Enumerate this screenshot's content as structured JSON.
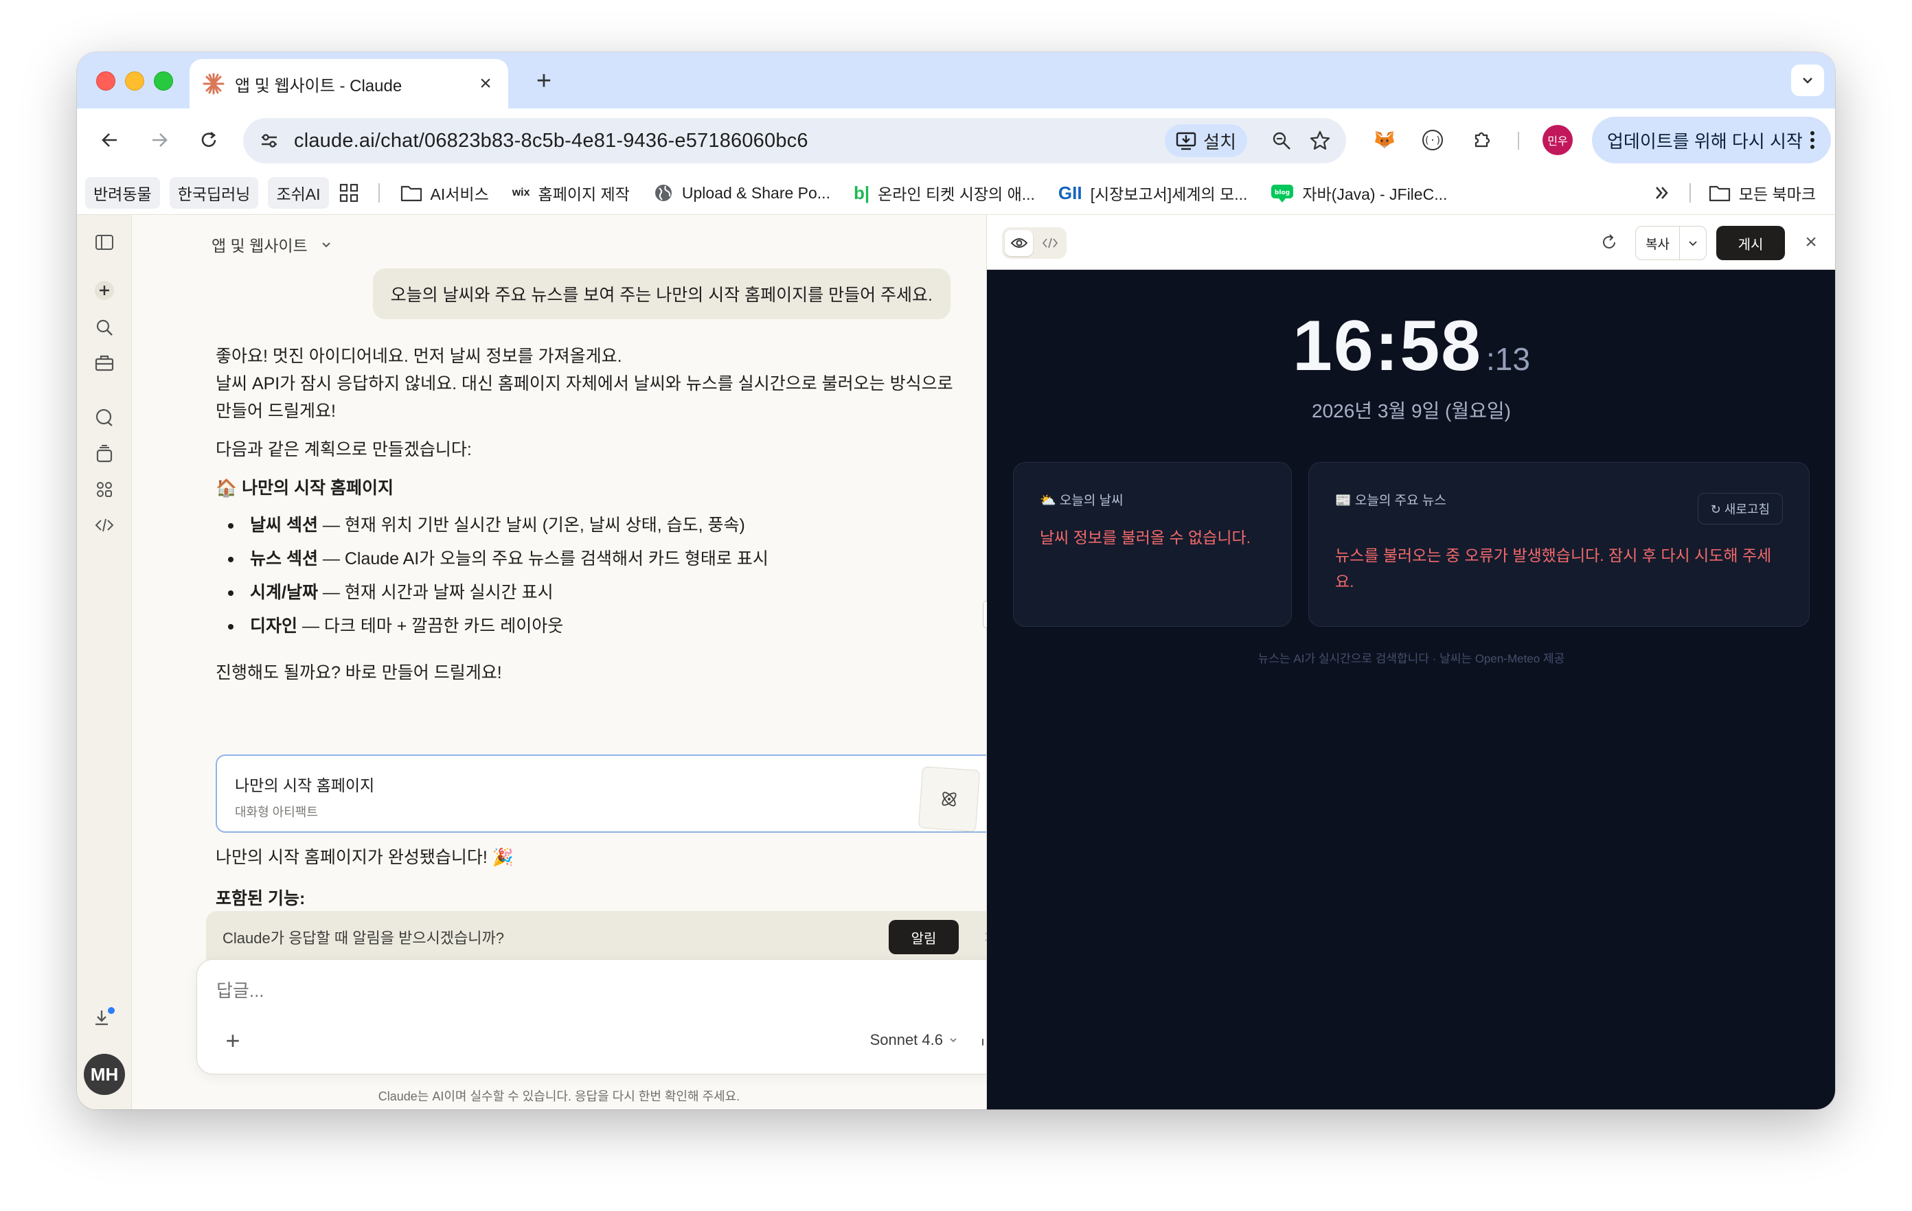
{
  "tab": {
    "title": "앱 및 웹사이트 - Claude",
    "close": "×",
    "new_tab": "+"
  },
  "toolbar": {
    "url": "claude.ai/chat/06823b83-8c5b-4e81-9436-e57186060bc6",
    "install_label": "설치",
    "profile_initials": "민우",
    "update_label": "업데이트를 위해 다시 시작"
  },
  "bookmarks": {
    "chips": [
      "반려동물",
      "한국딥러닝",
      "조쉬AI"
    ],
    "items": [
      {
        "label": "AI서비스",
        "icon": "folder-icon"
      },
      {
        "label": "홈페이지 제작",
        "icon": "wix-icon"
      },
      {
        "label": "Upload & Share Po...",
        "icon": "globe-icon"
      },
      {
        "label": "온라인 티켓 시장의 애...",
        "icon": "bl-icon"
      },
      {
        "label": "[시장보고서]세계의 모...",
        "icon": "gii-icon"
      },
      {
        "label": "자바(Java) - JFileC...",
        "icon": "blog-icon"
      }
    ],
    "all_bookmarks": "모든 북마크"
  },
  "chat": {
    "header_title": "앱 및 웹사이트",
    "user_message": "오늘의 날씨와 주요 뉴스를 보여 주는 나만의 시작 홈페이지를 만들어 주세요.",
    "intro_1": "좋아요! 멋진 아이디어네요. 먼저 날씨 정보를 가져올게요.",
    "intro_2": "날씨 API가 잠시 응답하지 않네요. 대신 홈페이지 자체에서 날씨와 뉴스를 실시간으로 불러오는 방식으로 만들어 드릴게요!",
    "plan_intro": "다음과 같은 계획으로 만들겠습니다:",
    "plan_title": "🏠 나만의 시작 홈페이지",
    "features": [
      {
        "name": "날씨 섹션",
        "desc": " — 현재 위치 기반 실시간 날씨 (기온, 날씨 상태, 습도, 풍속)"
      },
      {
        "name": "뉴스 섹션",
        "desc": " — Claude AI가 오늘의 주요 뉴스를 검색해서 카드 형태로 표시"
      },
      {
        "name": "시계/날짜",
        "desc": " — 현재 시간과 날짜 실시간 표시"
      },
      {
        "name": "디자인",
        "desc": " — 다크 테마 + 깔끔한 카드 레이아웃"
      }
    ],
    "proceed": "진행해도 될까요? 바로 만들어 드릴게요!",
    "artifact_title": "나만의 시작 홈페이지",
    "artifact_subtitle": "대화형 아티팩트",
    "done_message": "나만의 시작 홈페이지가 완성됐습니다! 🎉",
    "included_features": "포함된 기능:",
    "notify_message": "Claude가 응답할 때 알림을 받으시겠습니까?",
    "notify_button": "알림",
    "composer_placeholder": "답글...",
    "model": "Sonnet 4.6",
    "disclaimer": "Claude는 AI이며 실수할 수 있습니다. 응답을 다시 한번 확인해 주세요.",
    "user_initials": "MH"
  },
  "panel": {
    "copy_label": "복사",
    "publish_label": "게시",
    "clock_hm": "16:58",
    "clock_sec": ":13",
    "date": "2026년 3월 9일 (월요일)",
    "weather_title": "⛅ 오늘의 날씨",
    "weather_error": "날씨 정보를 불러올 수 없습니다.",
    "news_title": "📰 오늘의 주요 뉴스",
    "refresh_label": "↻ 새로고침",
    "news_error": "뉴스를 불러오는 중 오류가 발생했습니다. 잠시 후 다시 시도해 주세요.",
    "footnote": "뉴스는 AI가 실시간으로 검색합니다 · 날씨는 Open-Meteo 제공"
  },
  "colors": {
    "tab_strip": "#d3e3fd",
    "chat_bg": "#faf9f5",
    "preview_bg": "#0c1120",
    "error_red": "#f36a6a",
    "artifact_border": "#8fb4e6"
  }
}
